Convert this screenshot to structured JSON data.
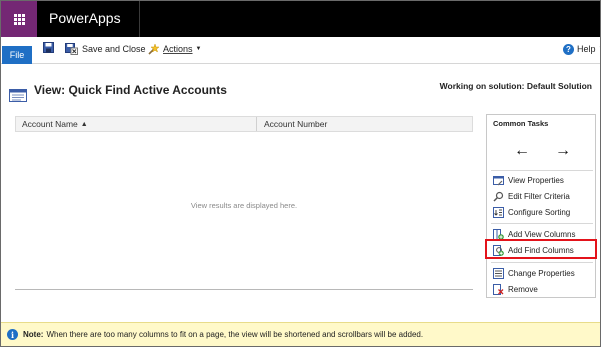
{
  "header": {
    "app_title": "PowerApps"
  },
  "ribbon": {
    "file_label": "File",
    "save_close_label": "Save and Close",
    "actions_label": "Actions",
    "help_label": "Help"
  },
  "view": {
    "title": "View: Quick Find Active Accounts",
    "solution": "Working on solution: Default Solution"
  },
  "grid": {
    "columns": [
      "Account Name",
      "Account Number"
    ],
    "empty_message": "View results are displayed here."
  },
  "tasks": {
    "title": "Common Tasks",
    "items": [
      "View Properties",
      "Edit Filter Criteria",
      "Configure Sorting",
      "Add View Columns",
      "Add Find Columns",
      "Change Properties",
      "Remove"
    ],
    "highlighted": "Add Find Columns"
  },
  "note": {
    "label": "Note:",
    "text": "When there are too many columns to fit on a page, the view will be shortened and scrollbars will be added."
  },
  "colors": {
    "brand": "#742774",
    "accent": "#1f6fc5",
    "highlight": "#e3131b",
    "note_bg": "#fff9c9"
  }
}
